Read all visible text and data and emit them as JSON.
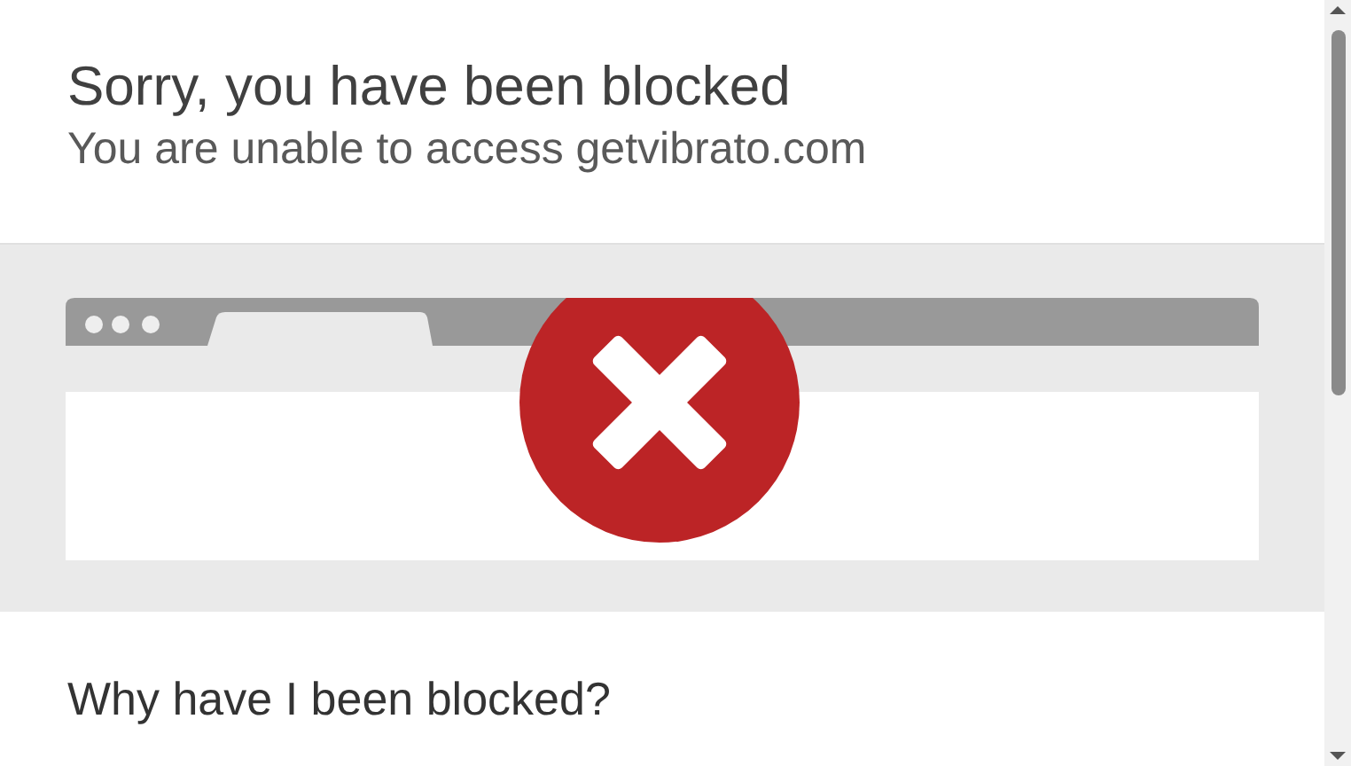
{
  "header": {
    "title": "Sorry, you have been blocked",
    "subtitle": "You are unable to access getvibrato.com"
  },
  "section": {
    "heading": "Why have I been blocked?"
  }
}
